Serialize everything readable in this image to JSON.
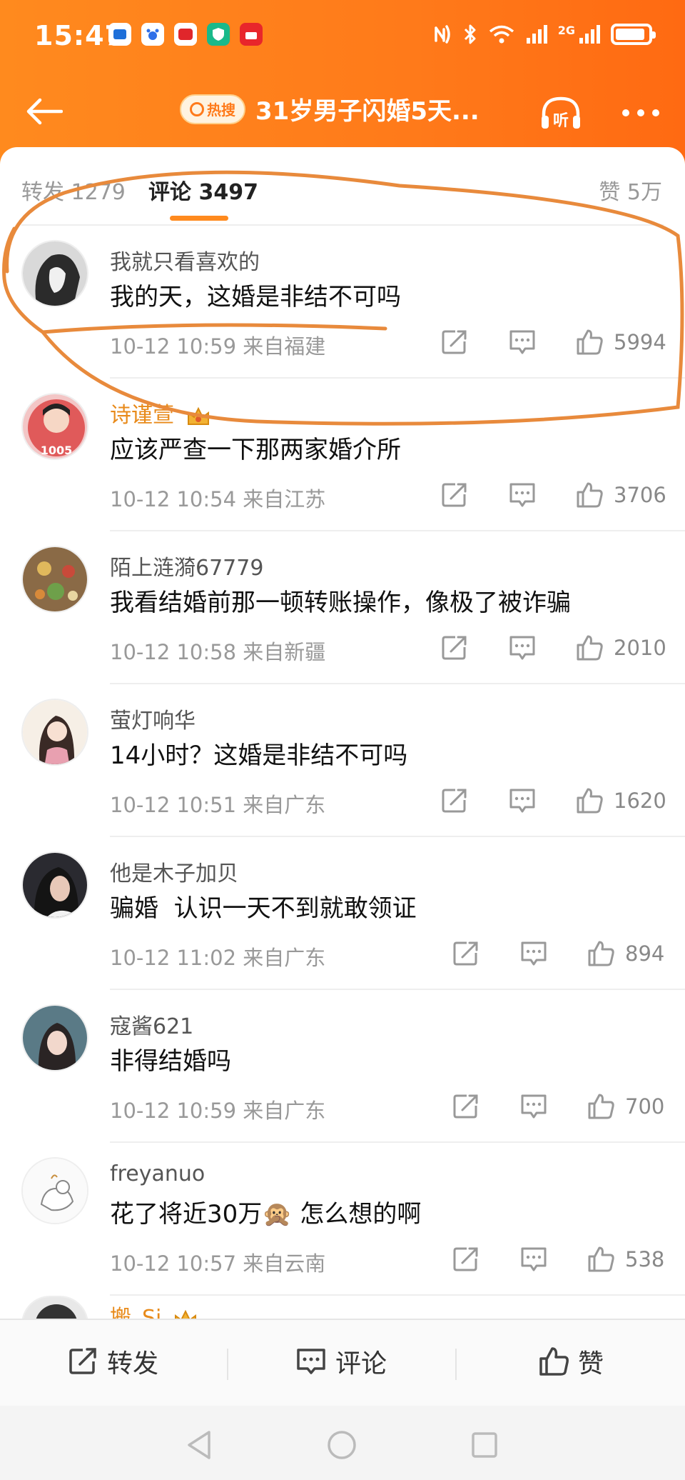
{
  "status_bar": {
    "time": "15:47",
    "notification_icons": [
      "news-app-icon",
      "baidu-icon",
      "mail-app-icon",
      "shield-app-icon",
      "pinduoduo-icon"
    ],
    "network_label": "2G"
  },
  "header": {
    "hot_badge": "热搜",
    "title": "31岁男子闪婚5天...",
    "listen_label": "听"
  },
  "tabs": {
    "repost": "转发 1279",
    "comment": "评论 3497",
    "like": "赞 5万"
  },
  "comments": [
    {
      "username": "我就只看喜欢的",
      "content": "我的天，这婚是非结不可吗",
      "time": "10-12 10:59",
      "location": "来自福建",
      "likes": "5994"
    },
    {
      "username": "诗谨萱",
      "content": "应该严查一下那两家婚介所",
      "time": "10-12 10:54",
      "location": "来自江苏",
      "likes": "3706"
    },
    {
      "username": "陌上涟漪67779",
      "content": "我看结婚前那一顿转账操作，像极了被诈骗",
      "time": "10-12 10:58",
      "location": "来自新疆",
      "likes": "2010"
    },
    {
      "username": "萤灯响华",
      "content": "14小时？这婚是非结不可吗",
      "time": "10-12 10:51",
      "location": "来自广东",
      "likes": "1620"
    },
    {
      "username": "他是木子加贝",
      "content": "骗婚  认识一天不到就敢领证",
      "time": "10-12 11:02",
      "location": "来自广东",
      "likes": "894"
    },
    {
      "username": "寇酱621",
      "content": "非得结婚吗",
      "time": "10-12 10:59",
      "location": "来自广东",
      "likes": "700"
    },
    {
      "username": "freyanuo",
      "content": "花了将近30万🙊 怎么想的啊",
      "time": "10-12 10:57",
      "location": "来自云南",
      "likes": "538"
    },
    {
      "username": "搬_Si"
    }
  ],
  "bottom_bar": {
    "repost": "转发",
    "comment": "评论",
    "like": "赞"
  },
  "colors": {
    "header_orange": "#ff7a1a",
    "vip_name": "#e88a1a",
    "highlight_stroke": "#e88a3c"
  }
}
